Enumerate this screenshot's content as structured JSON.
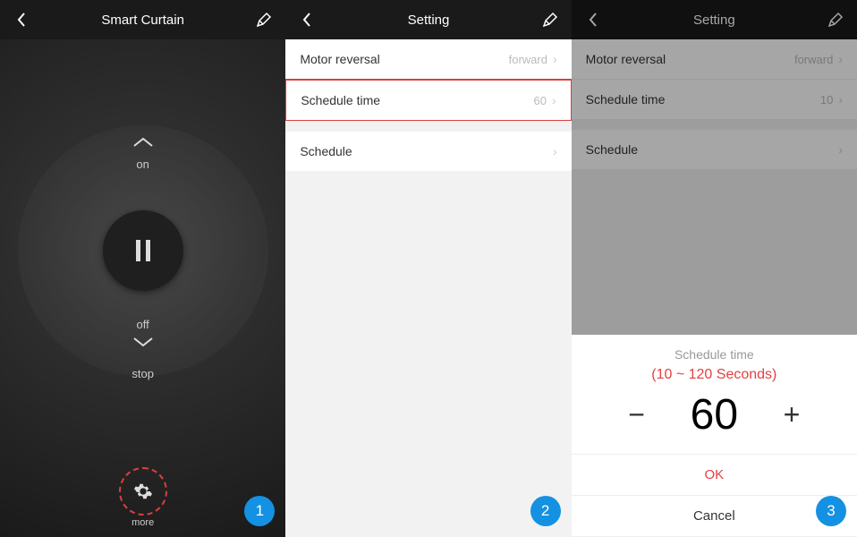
{
  "panel1": {
    "title": "Smart Curtain",
    "on_label": "on",
    "off_label": "off",
    "stop_label": "stop",
    "more_label": "more",
    "badge": "1"
  },
  "panel2": {
    "title": "Setting",
    "rows": {
      "motor_reversal": {
        "label": "Motor reversal",
        "value": "forward"
      },
      "schedule_time": {
        "label": "Schedule time",
        "value": "60"
      },
      "schedule": {
        "label": "Schedule",
        "value": ""
      }
    },
    "badge": "2"
  },
  "panel3": {
    "title": "Setting",
    "rows": {
      "motor_reversal": {
        "label": "Motor reversal",
        "value": "forward"
      },
      "schedule_time": {
        "label": "Schedule time",
        "value": "10"
      },
      "schedule": {
        "label": "Schedule",
        "value": ""
      }
    },
    "sheet": {
      "title": "Schedule time",
      "range": "(10 ~ 120  Seconds)",
      "value": "60",
      "ok": "OK",
      "cancel": "Cancel"
    },
    "badge": "3"
  }
}
